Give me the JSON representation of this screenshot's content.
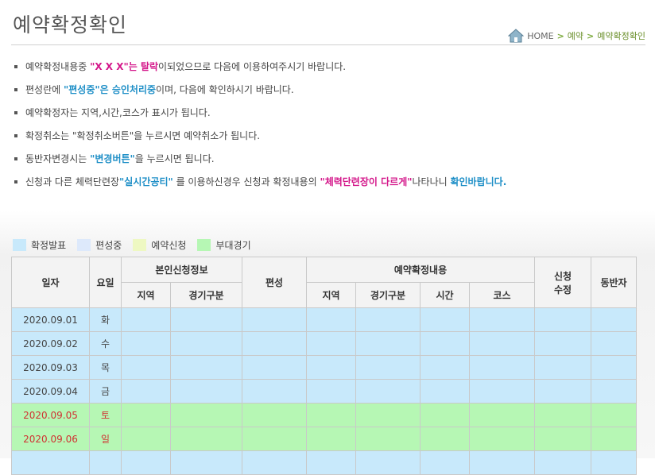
{
  "page": {
    "title": "예약확정확인"
  },
  "breadcrumb": {
    "home": "HOME",
    "level1": "예약",
    "level2": "예약확정확인",
    "separator": ">"
  },
  "notes": [
    {
      "segments": [
        {
          "text": "예약확정내용중 ",
          "style": ""
        },
        {
          "text": "\"X X X\"는 탈락",
          "style": "pink"
        },
        {
          "text": "이되었으므로 다음에 이용하여주시기 바랍니다.",
          "style": ""
        }
      ]
    },
    {
      "segments": [
        {
          "text": "편성란에 ",
          "style": ""
        },
        {
          "text": "\"편성중\"은 승인처리중",
          "style": "blue"
        },
        {
          "text": "이며, 다음에 확인하시기 바랍니다.",
          "style": ""
        }
      ]
    },
    {
      "segments": [
        {
          "text": "예약확정자는 지역,시간,코스가 표시가 됩니다.",
          "style": ""
        }
      ]
    },
    {
      "segments": [
        {
          "text": "확정취소는 \"확정취소버튼\"을 누르시면 예약취소가 됩니다.",
          "style": ""
        }
      ]
    },
    {
      "segments": [
        {
          "text": "동반자변경시는 ",
          "style": ""
        },
        {
          "text": "\"변경버튼\"",
          "style": "blue"
        },
        {
          "text": "을 누르시면 됩니다.",
          "style": ""
        }
      ]
    },
    {
      "segments": [
        {
          "text": "신청과 다른 체력단련장",
          "style": ""
        },
        {
          "text": "\"실시간공티\"",
          "style": "blue"
        },
        {
          "text": " 를 이용하신경우 신청과 확정내용의 ",
          "style": ""
        },
        {
          "text": "\"체력단련장이 다르게\"",
          "style": "pink"
        },
        {
          "text": "나타나니 ",
          "style": ""
        },
        {
          "text": "확인바랍니다.",
          "style": "blue"
        }
      ]
    }
  ],
  "legend": [
    {
      "label": "확정발표",
      "color": "#c8e9fb"
    },
    {
      "label": "편성중",
      "color": "#dde9fb"
    },
    {
      "label": "예약신청",
      "color": "#eef8c2"
    },
    {
      "label": "부대경기",
      "color": "#b6f7b4"
    }
  ],
  "table": {
    "headers": {
      "date": "일자",
      "day": "요일",
      "self_group": "본인신청정보",
      "self_region": "지역",
      "self_type": "경기구분",
      "assign": "편성",
      "confirm_group": "예약확정내용",
      "conf_region": "지역",
      "conf_type": "경기구분",
      "conf_time": "시간",
      "conf_course": "코스",
      "edit_line1": "신청",
      "edit_line2": "수정",
      "companion": "동반자"
    },
    "rows": [
      {
        "date": "2020.09.01",
        "day": "화",
        "status": "blue"
      },
      {
        "date": "2020.09.02",
        "day": "수",
        "status": "blue"
      },
      {
        "date": "2020.09.03",
        "day": "목",
        "status": "blue"
      },
      {
        "date": "2020.09.04",
        "day": "금",
        "status": "blue"
      },
      {
        "date": "2020.09.05",
        "day": "토",
        "status": "green"
      },
      {
        "date": "2020.09.06",
        "day": "일",
        "status": "green"
      },
      {
        "date": "",
        "day": "",
        "status": "blue"
      }
    ]
  }
}
